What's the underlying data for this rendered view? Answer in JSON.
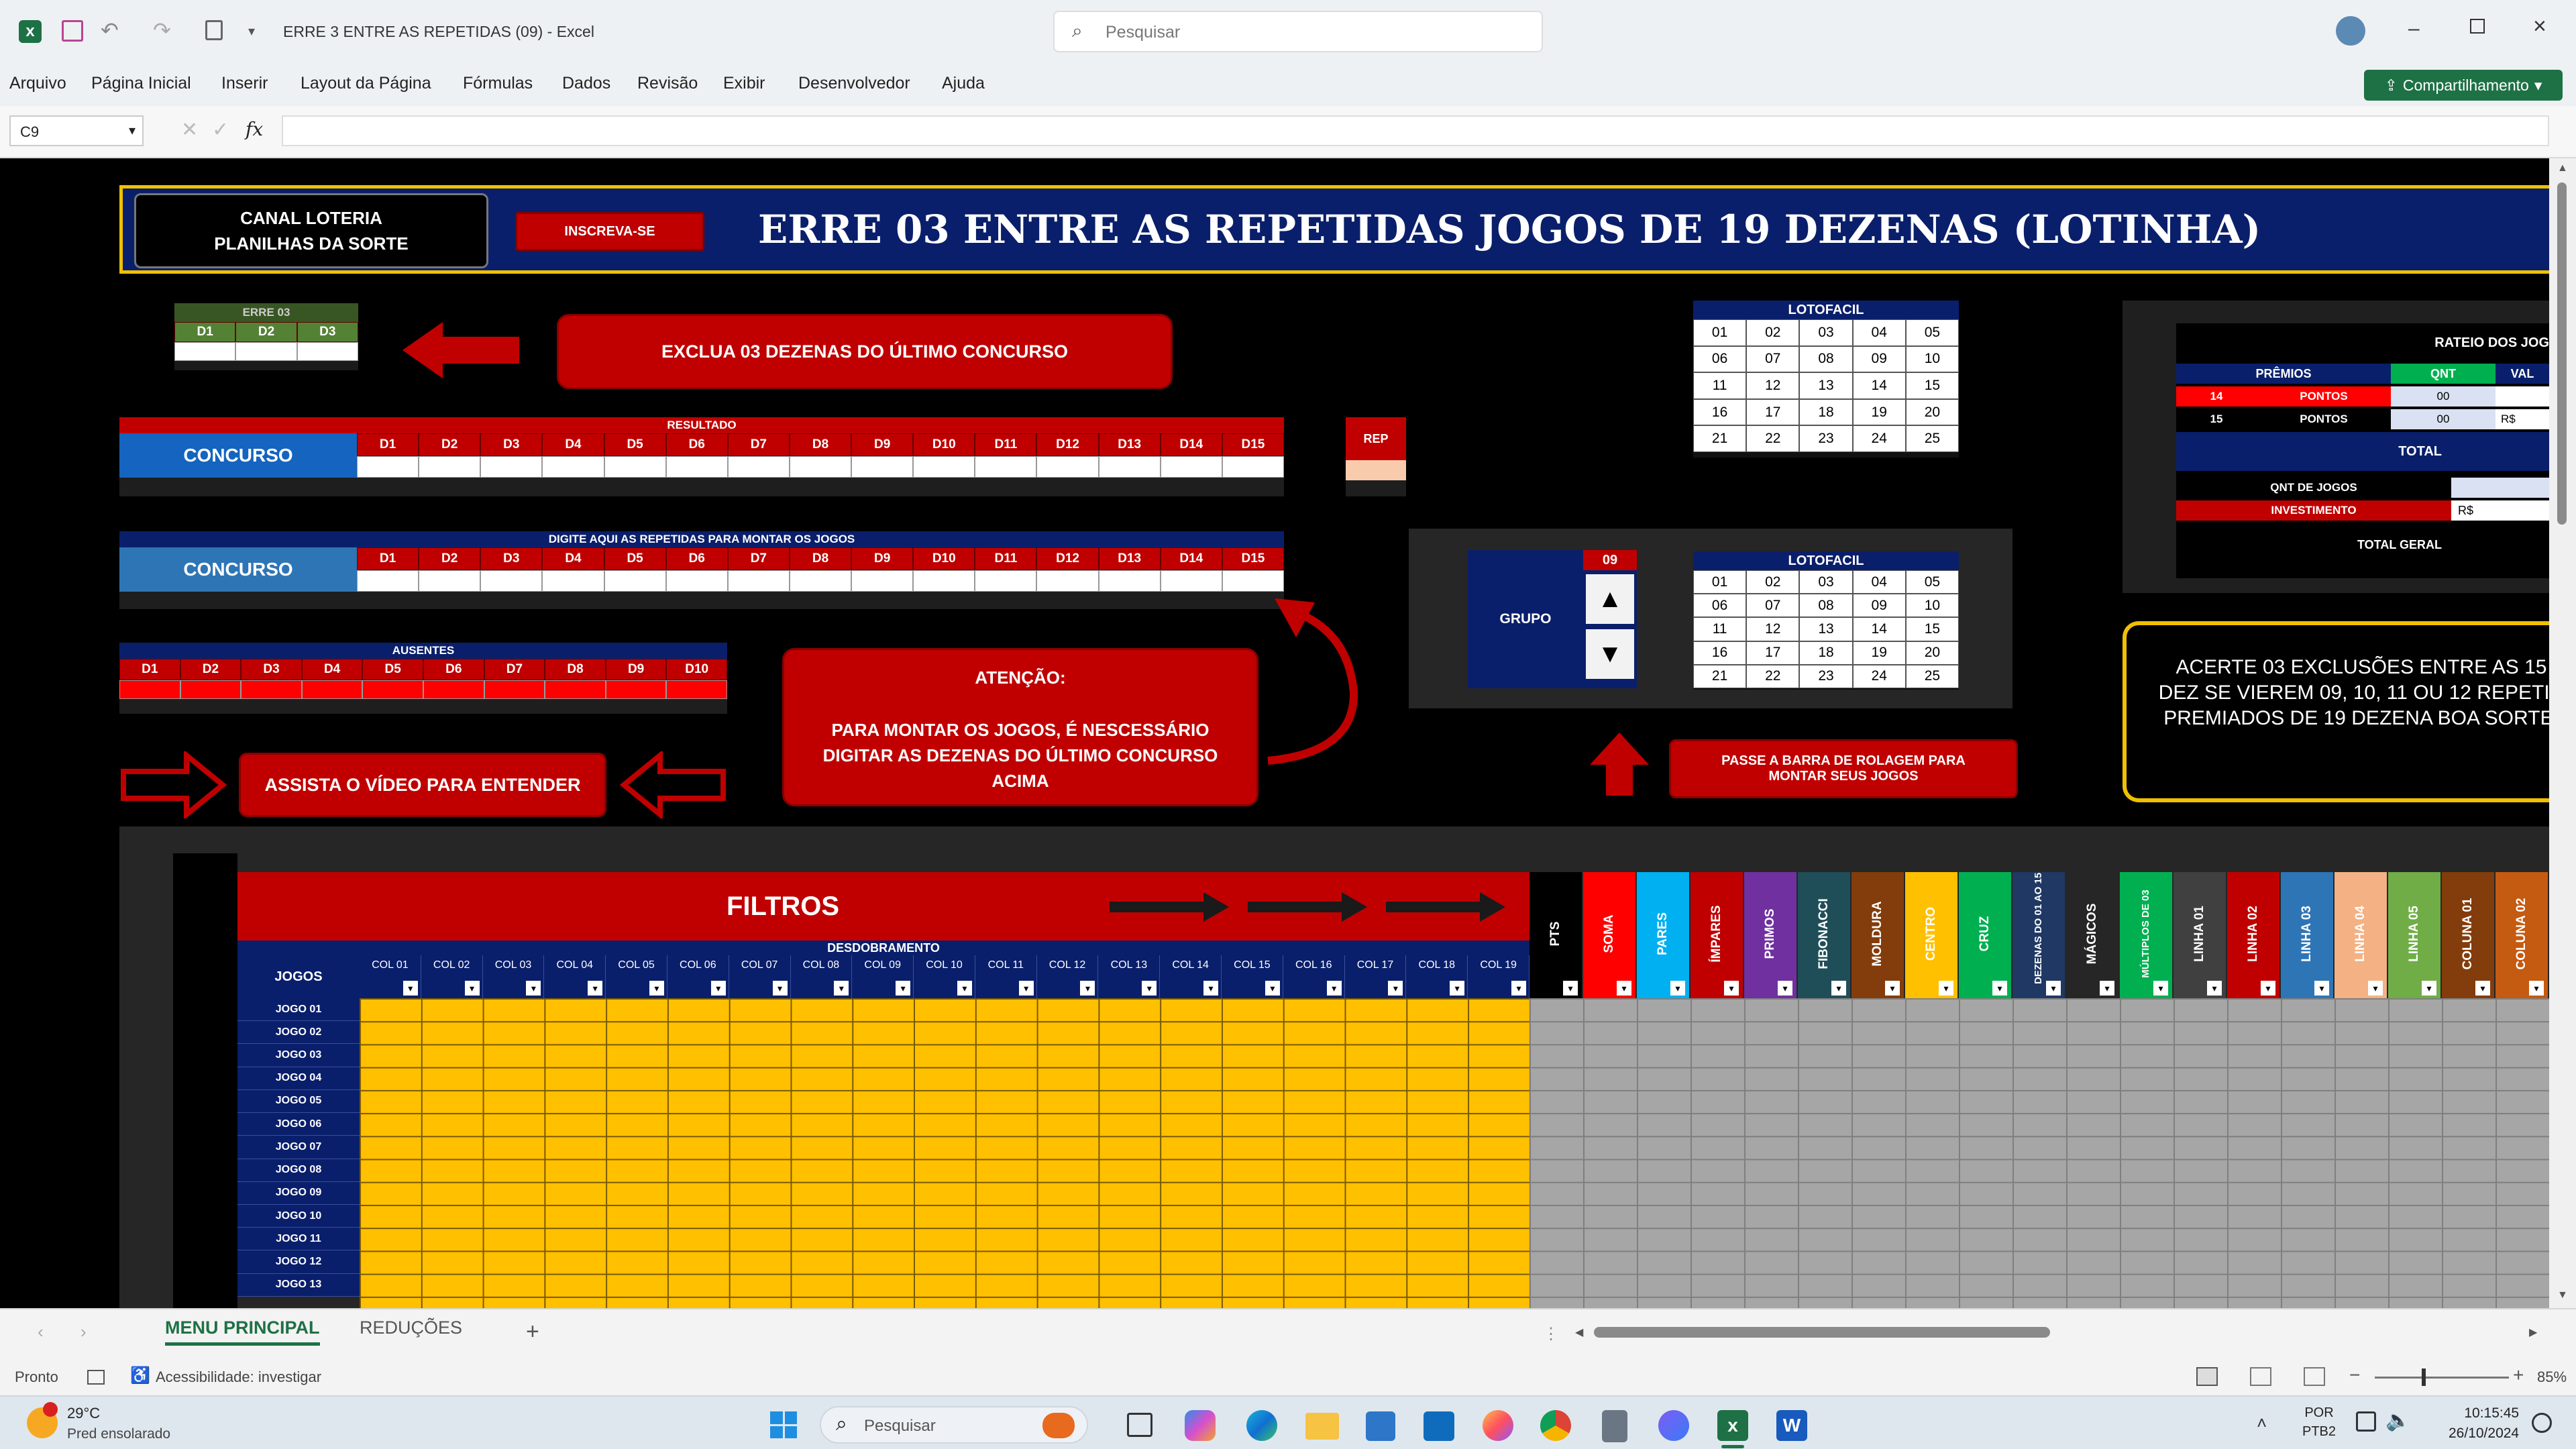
{
  "window": {
    "title": "ERRE 3 ENTRE AS REPETIDAS (09) - Excel",
    "search_placeholder": "Pesquisar",
    "share_label": "Compartilhamento"
  },
  "menu": [
    "Arquivo",
    "Página Inicial",
    "Inserir",
    "Layout da Página",
    "Fórmulas",
    "Dados",
    "Revisão",
    "Exibir",
    "Desenvolvedor",
    "Ajuda"
  ],
  "formula": {
    "name_box": "C9",
    "fx": "fx",
    "value": ""
  },
  "sheet": {
    "channel_label": "CANAL LOTERIA PLANILHAS DA SORTE",
    "subscribe_label": "INSCREVA-SE",
    "main_title": "ERRE 03 ENTRE AS REPETIDAS JOGOS DE 19 DEZENAS (LOTINHA)",
    "erre_header": "ERRE 03",
    "erre_cols": [
      "D1",
      "D2",
      "D3"
    ],
    "exclua_label": "EXCLUA 03 DEZENAS DO ÚLTIMO CONCURSO",
    "resultado_header": "RESULTADO",
    "concurso_label": "CONCURSO",
    "d_cols": [
      "D1",
      "D2",
      "D3",
      "D4",
      "D5",
      "D6",
      "D7",
      "D8",
      "D9",
      "D10",
      "D11",
      "D12",
      "D13",
      "D14",
      "D15"
    ],
    "rep_label": "REP",
    "digite_header": "DIGITE AQUI AS REPETIDAS PARA MONTAR OS JOGOS",
    "ausentes_header": "AUSENTES",
    "ausentes_cols": [
      "D1",
      "D2",
      "D3",
      "D4",
      "D5",
      "D6",
      "D7",
      "D8",
      "D9",
      "D10"
    ],
    "assista_label": "ASSISTA O VÍDEO PARA ENTENDER",
    "atencao_title": "ATENÇÃO:",
    "atencao_body": "PARA MONTAR OS JOGOS, É NESCESSÁRIO DIGITAR AS DEZENAS DO ÚLTIMO CONCURSO ACIMA",
    "lotofacil_header": "LOTOFACIL",
    "lotofacil_numbers": [
      "01",
      "02",
      "03",
      "04",
      "05",
      "06",
      "07",
      "08",
      "09",
      "10",
      "11",
      "12",
      "13",
      "14",
      "15",
      "16",
      "17",
      "18",
      "19",
      "20",
      "21",
      "22",
      "23",
      "24",
      "25"
    ],
    "grupo_label": "GRUPO",
    "grupo_value": "09",
    "passe_label": "PASSE A BARRA DE ROLAGEM PARA MONTAR SEUS JOGOS",
    "rateio_title": "RATEIO DOS JOG",
    "premios_header": "PRÊMIOS",
    "qnt_header": "QNT",
    "val_header": "VAL",
    "premio_rows": [
      {
        "num": "14",
        "label": "PONTOS",
        "qnt": "00",
        "val": ""
      },
      {
        "num": "15",
        "label": "PONTOS",
        "qnt": "00",
        "val": "R$"
      }
    ],
    "total_label": "TOTAL",
    "qnt_jogos_label": "QNT DE JOGOS",
    "investimento_label": "INVESTIMENTO",
    "investimento_val": "R$",
    "total_geral_label": "TOTAL GERAL",
    "acerte_text": "ACERTE 03 EXCLUSÕES ENTRE AS 15 DEZ SE VIEREM 09, 10, 11 OU 12 REPETID PREMIADOS DE 19 DEZENA BOA SORTE.",
    "filtros_label": "FILTROS",
    "desdobramento_label": "DESDOBRAMENTO",
    "jogos_label": "JOGOS",
    "col_headers": [
      "COL 01",
      "COL 02",
      "COL 03",
      "COL 04",
      "COL 05",
      "COL 06",
      "COL 07",
      "COL 08",
      "COL 09",
      "COL 10",
      "COL 11",
      "COL 12",
      "COL 13",
      "COL 14",
      "COL 15",
      "COL 16",
      "COL 17",
      "COL 18",
      "COL 19"
    ],
    "jogo_rows": [
      "JOGO 01",
      "JOGO 02",
      "JOGO 03",
      "JOGO 04",
      "JOGO 05",
      "JOGO 06",
      "JOGO 07",
      "JOGO 08",
      "JOGO 09",
      "JOGO 10",
      "JOGO 11",
      "JOGO 12",
      "JOGO 13"
    ],
    "filter_headers": [
      {
        "label": "PTS",
        "color": "#000000"
      },
      {
        "label": "SOMA",
        "color": "#ff0000"
      },
      {
        "label": "PARES",
        "color": "#00b0f0"
      },
      {
        "label": "ÍMPARES",
        "color": "#c00000"
      },
      {
        "label": "PRIMOS",
        "color": "#7030a0"
      },
      {
        "label": "FIBONACCI",
        "color": "#1f4e58"
      },
      {
        "label": "MOLDURA",
        "color": "#833c0b"
      },
      {
        "label": "CENTRO",
        "color": "#ffc000"
      },
      {
        "label": "CRUZ",
        "color": "#00b050"
      },
      {
        "label": "DEZENAS DO 01 AO 15",
        "color": "#203864"
      },
      {
        "label": "MÁGICOS",
        "color": "#262626"
      },
      {
        "label": "MÚLTIPLOS DE 03",
        "color": "#00b050"
      },
      {
        "label": "LINHA 01",
        "color": "#404040"
      },
      {
        "label": "LINHA 02",
        "color": "#c00000"
      },
      {
        "label": "LINHA 03",
        "color": "#2e75b6"
      },
      {
        "label": "LINHA 04",
        "color": "#f4b183"
      },
      {
        "label": "LINHA 05",
        "color": "#70ad47"
      },
      {
        "label": "COLUNA 01",
        "color": "#833c0b"
      },
      {
        "label": "COLUNA 02",
        "color": "#c55a11"
      }
    ]
  },
  "tabs": [
    {
      "label": "MENU PRINCIPAL",
      "active": true
    },
    {
      "label": "REDUÇÕES",
      "active": false
    }
  ],
  "add_tab": "+",
  "status": {
    "ready": "Pronto",
    "accessibility": "Acessibilidade: investigar",
    "zoom": "85%"
  },
  "taskbar": {
    "weather_temp": "29°C",
    "weather_desc": "Pred ensolarado",
    "search_placeholder": "Pesquisar",
    "lang1": "POR",
    "lang2": "PTB2",
    "time": "10:15:45",
    "date": "26/10/2024"
  },
  "colors": {
    "title_bg": "#0a1f6b",
    "title_border": "#f0c000",
    "red": "#c00000",
    "yellow": "#ffc000",
    "grey": "#a6a6a6",
    "excel_green": "#1e7145"
  }
}
